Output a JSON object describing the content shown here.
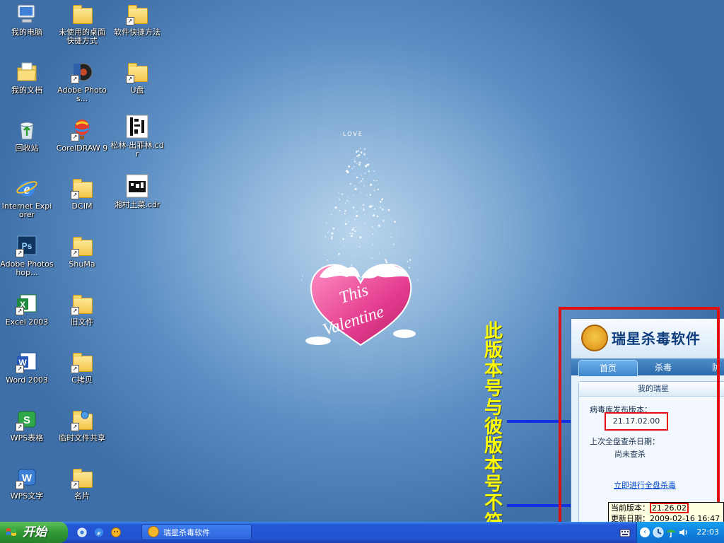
{
  "desktop": {
    "icons": [
      {
        "label": "我的电脑"
      },
      {
        "label": "未使用的桌面快捷方式"
      },
      {
        "label": "软件快捷方法"
      },
      {
        "label": "我的文档"
      },
      {
        "label": "Adobe Photos..."
      },
      {
        "label": "U盘"
      },
      {
        "label": "回收站"
      },
      {
        "label": "CorelDRAW 9"
      },
      {
        "label": "松林-出菲林.cdr"
      },
      {
        "label": "Internet Explorer"
      },
      {
        "label": "DCIM"
      },
      {
        "label": "湘村土菜.cdr"
      },
      {
        "label": "Adobe Photoshop..."
      },
      {
        "label": "ShuMa"
      },
      {
        "label": "Excel 2003"
      },
      {
        "label": "旧文件"
      },
      {
        "label": "Word 2003"
      },
      {
        "label": "C拷贝"
      },
      {
        "label": "WPS表格"
      },
      {
        "label": "临时文件共享"
      },
      {
        "label": "WPS文字"
      },
      {
        "label": "名片"
      }
    ],
    "wallpaper": {
      "love": "LOVE",
      "line1": "This",
      "line2": "Valentine"
    }
  },
  "annotation": {
    "text": "此版本号与彼版本号不符",
    "color": "#ffff00",
    "frame_color": "#e01010",
    "arrow_color": "#1330e0"
  },
  "rising": {
    "title": "瑞星杀毒软件",
    "tabs": [
      "首页",
      "杀毒",
      "防"
    ],
    "panel_title": "我的瑞星",
    "virus_db_label": "病毒库发布版本：",
    "virus_db_version": "21.17.02.00",
    "last_scan_label": "上次全盘查杀日期：",
    "last_scan_value": "尚未查杀",
    "scan_link": "立即进行全盘杀毒"
  },
  "tooltip": {
    "current_label": "当前版本：",
    "current_value": "21.26.02",
    "update_label": "更新日期：",
    "update_value": "2009-02-16 16:47"
  },
  "taskbar": {
    "start_label": "开始",
    "task_button": "瑞星杀毒软件",
    "clock": "22:03"
  }
}
